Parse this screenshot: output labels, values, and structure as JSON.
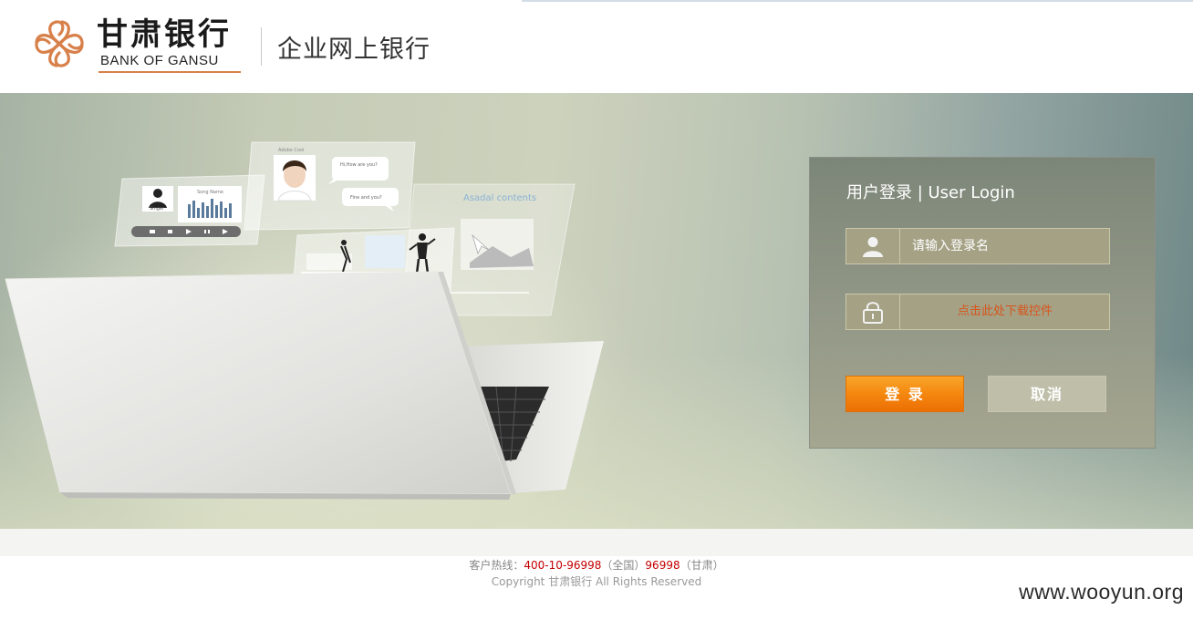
{
  "header": {
    "logo_cn": "甘肃银行",
    "logo_en": "BANK OF GANSU",
    "title": "企业网上银行"
  },
  "banner": {
    "illustration": {
      "card_names": [
        "Singer",
        "Song Name",
        "Adobe Cool"
      ],
      "chat_bubbles": [
        "Hi,How are you?",
        "Fine and you?"
      ],
      "content_label": "Asadal contents"
    }
  },
  "login": {
    "title": "用户登录 | User Login",
    "username_placeholder": "请输入登录名",
    "user_icon": "user-icon",
    "lock_icon": "lock-icon",
    "plugin_link": "点击此处下载控件",
    "login_button": "登 录",
    "cancel_button": "取消"
  },
  "footer": {
    "hotline_label": "客户热线：",
    "hotline_national": "400-10-96998",
    "national_note": "（全国）",
    "hotline_local": "96998",
    "local_note": "（甘肃）",
    "copyright": "Copyright 甘肃银行 All Rights Reserved"
  },
  "watermark": "www.wooyun.org",
  "colors": {
    "accent_orange": "#f5870f",
    "link_orange": "#d9551b",
    "hotline_red": "#c40000",
    "logo_orange": "#d8804a"
  }
}
